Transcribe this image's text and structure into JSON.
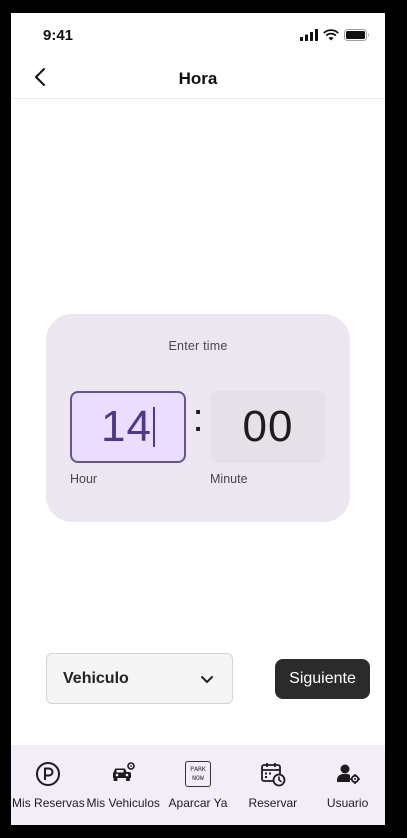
{
  "status_bar": {
    "time": "9:41"
  },
  "header": {
    "title": "Hora"
  },
  "time_picker": {
    "label": "Enter time",
    "hour": "14",
    "minute": "00",
    "separator": ":",
    "hour_label": "Hour",
    "minute_label": "Minute"
  },
  "vehicle_select": {
    "label": "Vehiculo"
  },
  "next_button": {
    "label": "Siguiente"
  },
  "nav": {
    "items": [
      {
        "label": "Mis Reservas",
        "icon": "parking-icon"
      },
      {
        "label": "Mis Vehiculos",
        "icon": "car-gear-icon"
      },
      {
        "label": "Aparcar Ya",
        "icon": "park-now-icon",
        "icon_text": "PARK NOW"
      },
      {
        "label": "Reservar",
        "icon": "calendar-clock-icon"
      },
      {
        "label": "Usuario",
        "icon": "user-gear-icon"
      }
    ]
  },
  "colors": {
    "card_bg": "#ece6f0",
    "hour_bg": "#eaddff",
    "accent": "#65558f",
    "nav_bg": "#f3edf7",
    "button_bg": "#2b2b2b"
  }
}
